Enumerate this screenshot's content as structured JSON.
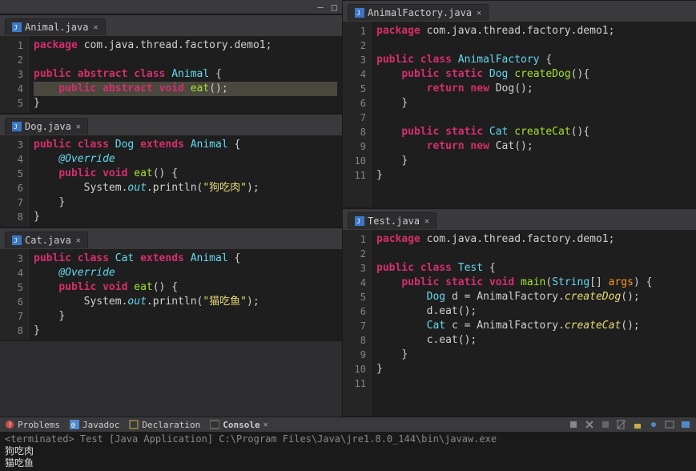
{
  "window": {
    "min": "—",
    "max": "□"
  },
  "tabs": {
    "animal": "Animal.java",
    "dog": "Dog.java",
    "cat": "Cat.java",
    "factory": "AnimalFactory.java",
    "test": "Test.java"
  },
  "code": {
    "animal": [
      "package com.java.thread.factory.demo1;",
      "",
      "public abstract class Animal {",
      "    public abstract void eat();",
      "}"
    ],
    "dog": [
      "public class Dog extends Animal {",
      "    @Override",
      "    public void eat() {",
      "        System.out.println(\"狗吃肉\");",
      "    }",
      "}"
    ],
    "cat": [
      "public class Cat extends Animal {",
      "    @Override",
      "    public void eat() {",
      "        System.out.println(\"猫吃鱼\");",
      "    }",
      "}"
    ],
    "factory": [
      "package com.java.thread.factory.demo1;",
      "",
      "public class AnimalFactory {",
      "    public static Dog createDog(){",
      "        return new Dog();",
      "    }",
      "",
      "    public static Cat createCat(){",
      "        return new Cat();",
      "    }",
      "}"
    ],
    "test": [
      "package com.java.thread.factory.demo1;",
      "",
      "public class Test {",
      "    public static void main(String[] args) {",
      "        Dog d = AnimalFactory.createDog();",
      "        d.eat();",
      "        Cat c = AnimalFactory.createCat();",
      "        c.eat();",
      "    }",
      "}",
      ""
    ],
    "dog_start": 3,
    "cat_start": 3
  },
  "bottom": {
    "problems": "Problems",
    "javadoc": "Javadoc",
    "declaration": "Declaration",
    "console": "Console",
    "terminated": "<terminated> Test [Java Application] C:\\Program Files\\Java\\jre1.8.0_144\\bin\\javaw.exe",
    "output": [
      "狗吃肉",
      "猫吃鱼"
    ]
  }
}
